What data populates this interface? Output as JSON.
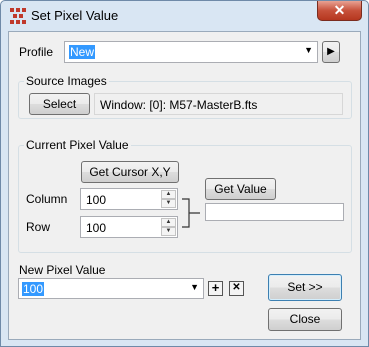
{
  "window": {
    "title": "Set Pixel Value",
    "close_glyph": "✕"
  },
  "profile": {
    "label": "Profile",
    "value": "New",
    "more_glyph": "▶"
  },
  "source_images": {
    "title": "Source Images",
    "select_label": "Select",
    "window_text": "Window: [0]: M57-MasterB.fts"
  },
  "current_pixel": {
    "title": "Current Pixel Value",
    "get_cursor_label": "Get Cursor X,Y",
    "column_label": "Column",
    "column_value": "100",
    "row_label": "Row",
    "row_value": "100",
    "get_value_label": "Get Value",
    "value_text": ""
  },
  "new_pixel": {
    "title": "New Pixel Value",
    "value": "100",
    "add_glyph": "+",
    "remove_glyph": "✕"
  },
  "buttons": {
    "set_label": "Set >>",
    "close_label": "Close"
  },
  "icons": {
    "app": "app-grid-icon",
    "close": "close-icon",
    "dropdown": "chevron-down-icon",
    "more": "triangle-right-icon",
    "spin_up": "arrow-up-icon",
    "spin_down": "arrow-down-icon",
    "bracket": "bracket-icon",
    "add": "plus-icon",
    "remove": "x-icon"
  },
  "colors": {
    "titlebar": "#d9e6f3",
    "close_button": "#c7513b",
    "selection": "#3399ff",
    "client_bg": "#f0f0f0"
  }
}
